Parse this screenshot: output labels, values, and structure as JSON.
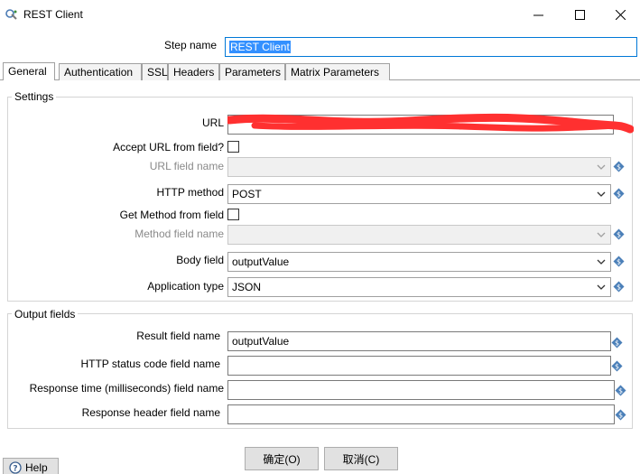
{
  "window": {
    "title": "REST Client",
    "minimize": "—",
    "maximize": "☐",
    "close": "✕"
  },
  "step": {
    "label": "Step name",
    "value": "REST Client"
  },
  "tabs": [
    "General",
    "Authentication",
    "SSL",
    "Headers",
    "Parameters",
    "Matrix Parameters"
  ],
  "settings": {
    "title": "Settings",
    "url_label": "URL",
    "accept_url_label": "Accept URL from field?",
    "url_field_label": "URL field name",
    "http_method_label": "HTTP method",
    "http_method_value": "POST",
    "get_method_label": "Get Method from field",
    "method_field_label": "Method field name",
    "body_field_label": "Body field",
    "body_field_value": "outputValue",
    "app_type_label": "Application type",
    "app_type_value": "JSON"
  },
  "output": {
    "title": "Output fields",
    "result_label": "Result field name",
    "result_value": "outputValue",
    "status_label": "HTTP status code field name",
    "response_time_label": "Response time (milliseconds) field name",
    "response_header_label": "Response header field name"
  },
  "buttons": {
    "ok": "确定(O)",
    "cancel": "取消(C)",
    "help": "Help"
  },
  "colors": {
    "accent": "#0078d7",
    "redaction": "#ff3030",
    "var_icon": "#4a7fb8"
  }
}
